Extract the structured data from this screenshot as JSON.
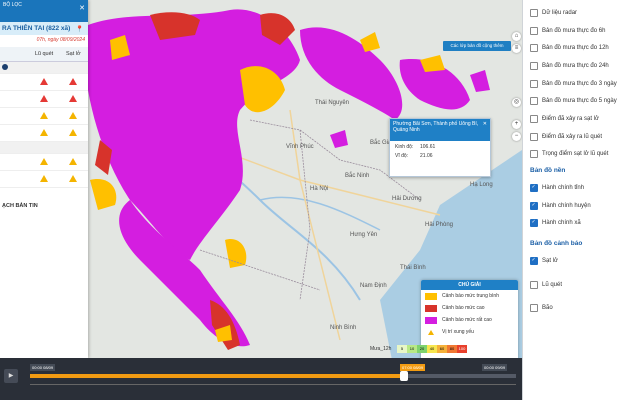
{
  "left_panel": {
    "top_text": "BỘ LỌC",
    "close_glyph": "✕",
    "header": "RA THIÊN TAI (822 xã)",
    "date": "07h, ngày 08/09/2024",
    "columns": [
      "",
      "Lũ quét",
      "Sạt lở"
    ],
    "footer": "ẠCH BẢN TIN"
  },
  "map": {
    "top_button": "Các lớp bản đồ cộng thêm",
    "place_labels": [
      "Thái Nguyên",
      "Vĩnh Phúc",
      "Bắc Ninh",
      "Hà Nội",
      "Bắc Giang",
      "Hải Phòng",
      "Hưng Yên",
      "Hải Dương",
      "Nam Định",
      "Ninh Bình",
      "Thái Bình",
      "Hạ Long"
    ],
    "controls": [
      "home-icon",
      "layers-icon",
      "locate-icon",
      "zoom-in-icon",
      "zoom-out-icon"
    ]
  },
  "popup": {
    "title": "Phường Bãi Sơn, Thành phố Uông Bí, Quảng Ninh",
    "close_glyph": "✕",
    "rows": [
      {
        "label": "Kinh độ:",
        "value": "106.61"
      },
      {
        "label": "Vĩ độ:",
        "value": "21.06"
      }
    ]
  },
  "legend": {
    "title": "CHÚ GIẢI",
    "items": [
      {
        "label": "Cảnh báo mức trung bình",
        "color": "#ffc000"
      },
      {
        "label": "Cảnh báo mức cao",
        "color": "#d7332b"
      },
      {
        "label": "Cảnh báo mức rất cao",
        "color": "#d41ee0"
      },
      {
        "label": "Vị trí xung yếu",
        "color": "#f5c400"
      }
    ]
  },
  "rain_scale": {
    "label": "Mưa_12h",
    "steps": [
      {
        "v": "5",
        "color": "#e8f7c7"
      },
      {
        "v": "10",
        "color": "#b8e986"
      },
      {
        "v": "20",
        "color": "#7fd36d"
      },
      {
        "v": "40",
        "color": "#f7e64f"
      },
      {
        "v": "60",
        "color": "#f5b13a"
      },
      {
        "v": "80",
        "color": "#f07833"
      },
      {
        "v": "100",
        "color": "#e8402c"
      }
    ]
  },
  "timeline": {
    "start_time": "00:00 08/09",
    "current_time": "07:00 08/09",
    "end_time": "00:00 09/09",
    "progress": 0.77,
    "play_glyph": "▶"
  },
  "right_panel": {
    "layers": [
      {
        "label": "Dữ liệu radar",
        "checked": false
      },
      {
        "label": "Bản đồ mưa thực đo 6h",
        "checked": false
      },
      {
        "label": "Bản đồ mưa thực đo 12h",
        "checked": false
      },
      {
        "label": "Bản đồ mưa thực đo 24h",
        "checked": false
      },
      {
        "label": "Bản đồ mưa thực đo 3 ngày",
        "checked": false
      },
      {
        "label": "Bản đồ mưa thực đo 5 ngày",
        "checked": false
      },
      {
        "label": "Điểm đã xảy ra sạt lở",
        "checked": false
      },
      {
        "label": "Điểm đã xảy ra lũ quét",
        "checked": false
      },
      {
        "label": "Trọng điểm sạt lở lũ quét",
        "checked": false
      }
    ],
    "base_title": "Bản đồ nền",
    "base_layers": [
      {
        "label": "Hành chính tỉnh",
        "checked": true
      },
      {
        "label": "Hành chính huyện",
        "checked": true
      },
      {
        "label": "Hành chính xã",
        "checked": true
      }
    ],
    "warning_title": "Bản đồ cảnh báo",
    "warning_layers": [
      {
        "label": "Sạt lở",
        "checked": true
      },
      {
        "label": "Lũ quét",
        "checked": false
      },
      {
        "label": "Bão",
        "checked": false
      }
    ]
  }
}
